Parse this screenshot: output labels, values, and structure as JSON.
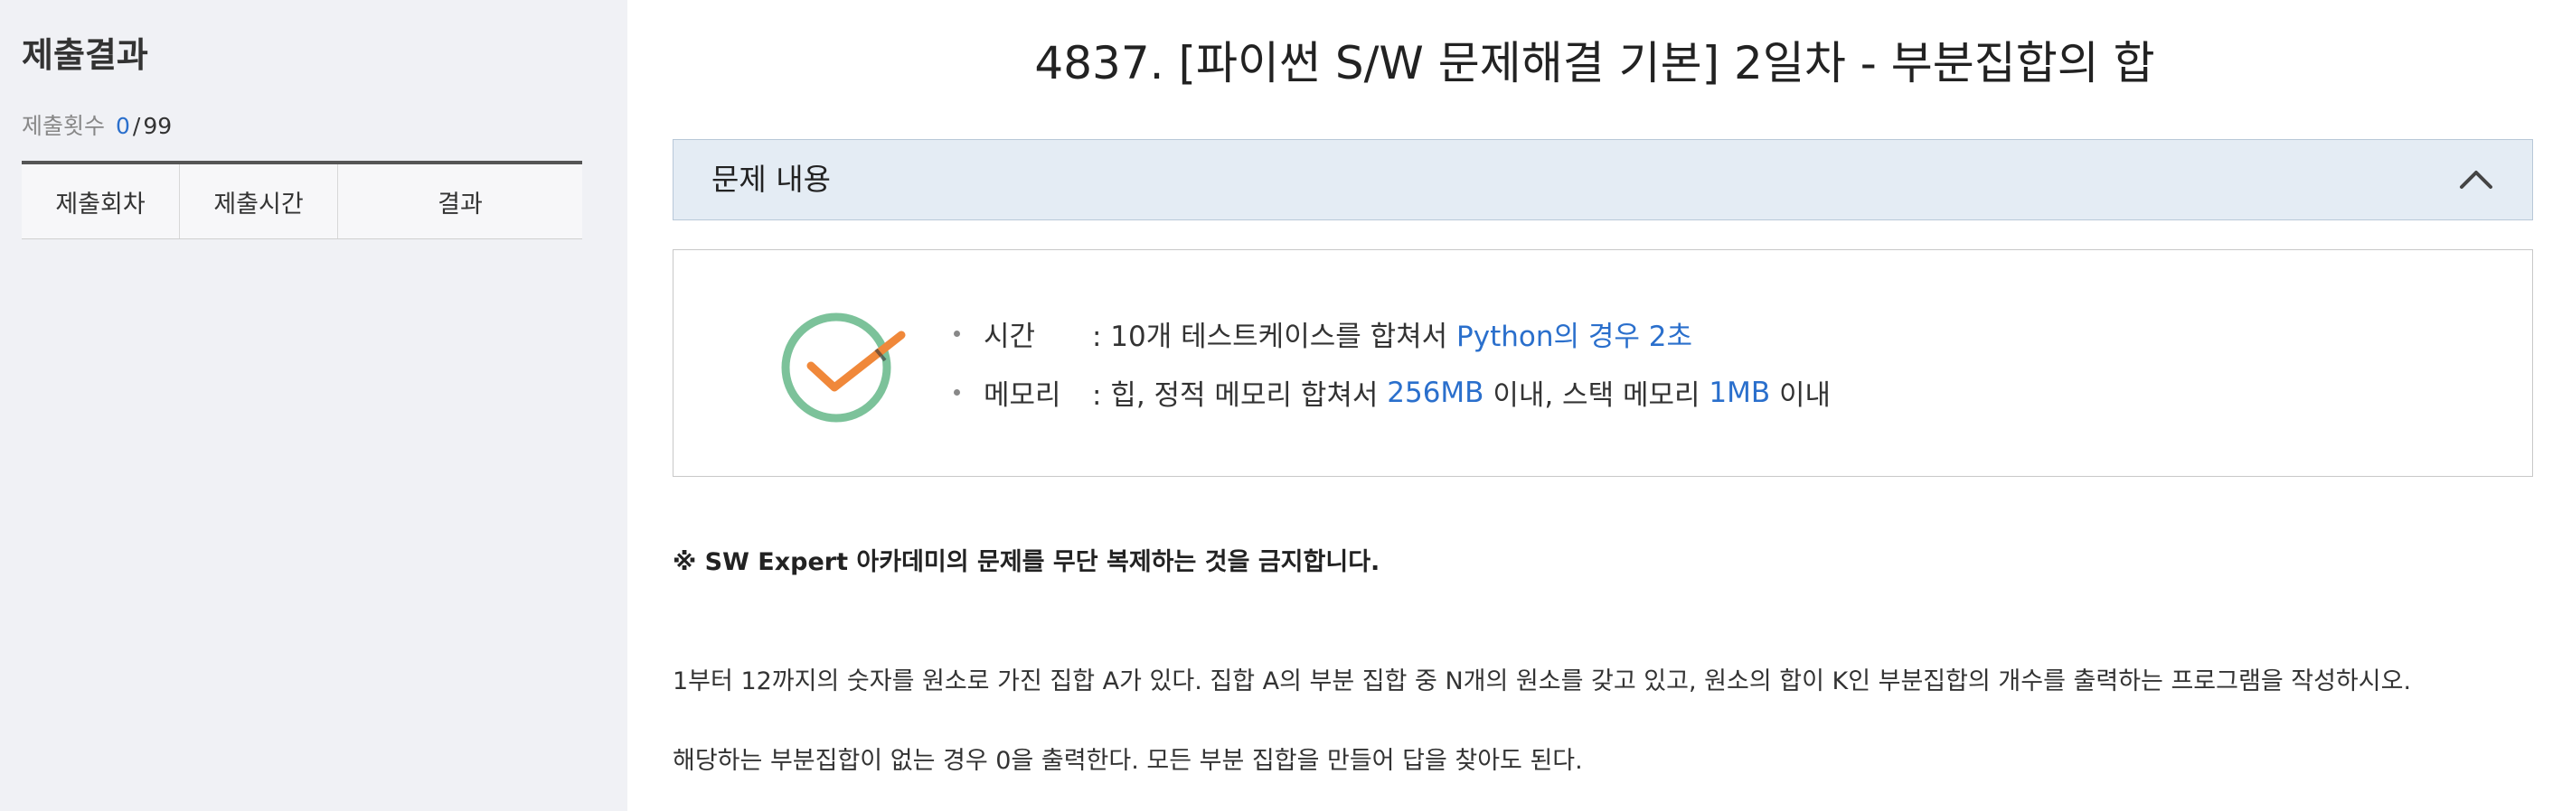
{
  "sidebar": {
    "title": "제출결과",
    "submit_count": {
      "label": "제출횟수",
      "current": "0",
      "separator": "/",
      "max": "99"
    },
    "table_headers": [
      "제출회차",
      "제출시간",
      "결과"
    ]
  },
  "problem": {
    "title": "4837. [파이썬 S/W 문제해결 기본] 2일차 - 부분집합의 합",
    "accordion_label": "문제 내용",
    "limits": {
      "time_label": "시간",
      "time_text": ": 10개 테스트케이스를 합쳐서",
      "time_highlight": "Python의 경우 2초",
      "memory_label": "메모리",
      "memory_text1": ": 힙, 정적 메모리 합쳐서",
      "memory_hl1": "256MB",
      "memory_text2": "이내, 스택 메모리",
      "memory_hl2": "1MB",
      "memory_text3": "이내"
    },
    "warning": "※ SW Expert 아카데미의 문제를 무단 복제하는 것을 금지합니다.",
    "description": [
      "1부터 12까지의 숫자를 원소로 가진 집합 A가 있다. 집합 A의 부분 집합 중 N개의 원소를 갖고 있고, 원소의 합이 K인 부분집합의 개수를 출력하는 프로그램을 작성하시오.",
      "해당하는 부분집합이 없는 경우 0을 출력한다. 모든 부분 집합을 만들어 답을 찾아도 된다."
    ]
  },
  "icons": {
    "accordion_toggle": "chevron-up-icon",
    "limits": "check-circle-icon"
  },
  "colors": {
    "highlight": "#2a6fcc",
    "check_circle": "#7cc29a",
    "check_mark": "#f0883a",
    "accordion_bg": "#e4ecf4",
    "sidebar_bg": "#f0f1f5"
  }
}
